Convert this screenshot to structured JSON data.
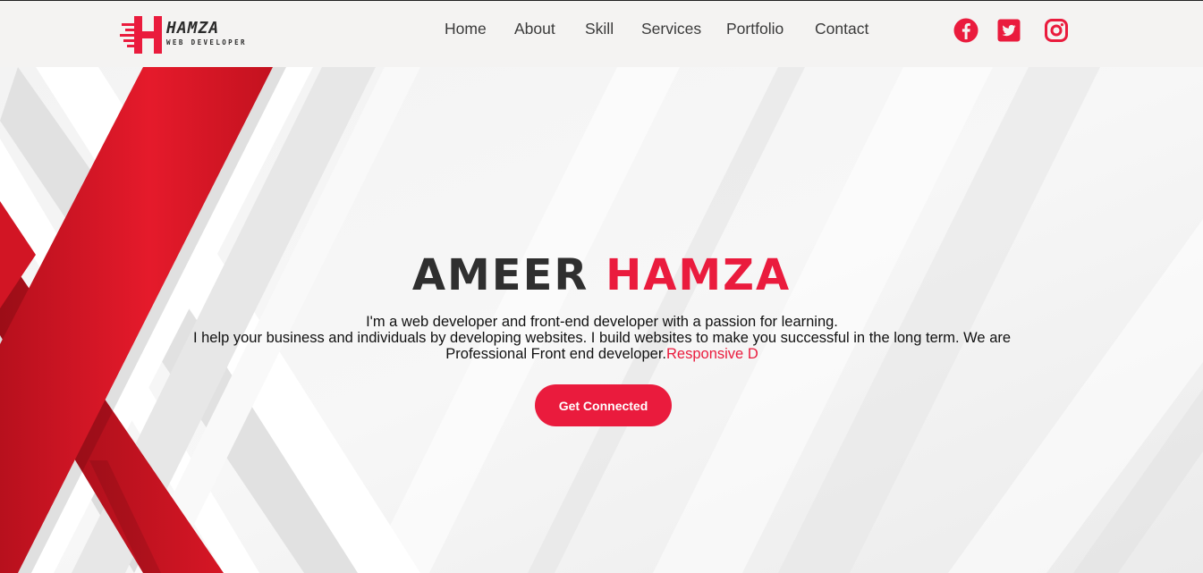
{
  "brand": {
    "name": "HAMZA",
    "tagline": "WEB DEVELOPER",
    "accent": "#ea1b3d",
    "dark": "#2f2f2f"
  },
  "nav": {
    "home": "Home",
    "about": "About",
    "skill": "Skill",
    "services": "Services",
    "portfolio": "Portfolio",
    "contact": "Contact"
  },
  "social": {
    "facebook_icon": "facebook-icon",
    "twitter_icon": "twitter-icon",
    "instagram_icon": "instagram-icon"
  },
  "hero": {
    "first_name": "AMEER",
    "last_name": "HAMZA",
    "line1": "I'm a web developer and front-end developer with a passion for learning.",
    "line2": "I help your business and individuals by developing websites. I build websites to make you successful in the long term. We are Professional Front end developer.",
    "typed_text": "Responsive D",
    "cta_label": "Get Connected"
  }
}
